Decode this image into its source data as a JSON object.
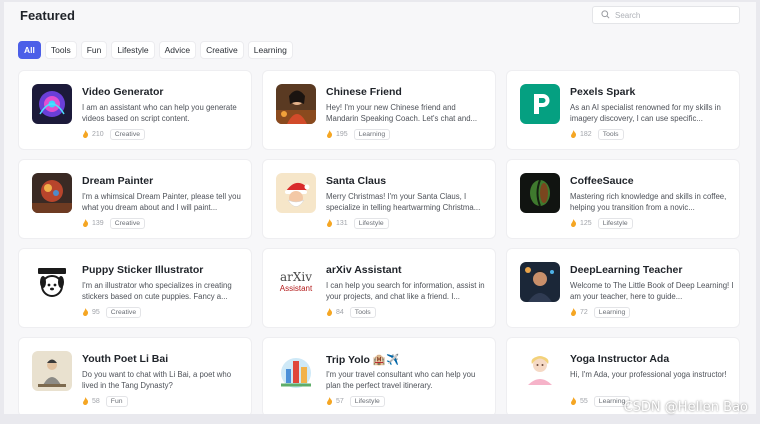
{
  "header": {
    "title": "Featured",
    "search_placeholder": "Search"
  },
  "tabs": [
    {
      "label": "All",
      "active": true
    },
    {
      "label": "Tools",
      "active": false
    },
    {
      "label": "Fun",
      "active": false
    },
    {
      "label": "Lifestyle",
      "active": false
    },
    {
      "label": "Advice",
      "active": false
    },
    {
      "label": "Creative",
      "active": false
    },
    {
      "label": "Learning",
      "active": false
    }
  ],
  "cards": [
    {
      "name": "Video Generator",
      "desc": "I am an assistant who can help you generate videos based on script content.",
      "hot": "210",
      "tag": "Creative",
      "icon": "video-generator-avatar"
    },
    {
      "name": "Chinese Friend",
      "desc": "Hey! I'm your new Chinese friend and Mandarin Speaking Coach. Let's chat and...",
      "hot": "195",
      "tag": "Learning",
      "icon": "chinese-friend-avatar"
    },
    {
      "name": "Pexels Spark",
      "desc": "As an AI specialist renowned for my skills in imagery discovery, I can use specific...",
      "hot": "182",
      "tag": "Tools",
      "icon": "pexels-logo"
    },
    {
      "name": "Dream Painter",
      "desc": "I'm a whimsical Dream Painter, please tell you what you dream about and I will paint...",
      "hot": "139",
      "tag": "Creative",
      "icon": "dream-painter-avatar"
    },
    {
      "name": "Santa Claus",
      "desc": "Merry Christmas! I'm your Santa Claus, I specialize in telling heartwarming Christma...",
      "hot": "131",
      "tag": "Lifestyle",
      "icon": "santa-claus-avatar"
    },
    {
      "name": "CoffeeSauce",
      "desc": "Mastering rich knowledge and skills in coffee, helping you transition from a novic...",
      "hot": "125",
      "tag": "Lifestyle",
      "icon": "coffee-bean-avatar"
    },
    {
      "name": "Puppy Sticker Illustrator",
      "desc": "I'm an illustrator who specializes in creating stickers based on cute puppies. Fancy a...",
      "hot": "95",
      "tag": "Creative",
      "icon": "puppy-sticker-avatar"
    },
    {
      "name": "arXiv Assistant",
      "desc": "I can help you search for information, assist in your projects, and chat like a friend. I...",
      "hot": "84",
      "tag": "Tools",
      "icon": "arxiv-logo",
      "logo_text_1": "arXiv",
      "logo_text_2": "Assistant"
    },
    {
      "name": "DeepLearning Teacher",
      "desc": "Welcome to The Little Book of Deep Learning! I am your teacher, here to guide...",
      "hot": "72",
      "tag": "Learning",
      "icon": "deeplearning-teacher-avatar"
    },
    {
      "name": "Youth Poet Li Bai",
      "desc": "Do you want to chat with Li Bai, a poet who lived in the Tang Dynasty?",
      "hot": "58",
      "tag": "Fun",
      "icon": "li-bai-avatar"
    },
    {
      "name": "Trip Yolo 🏨✈️",
      "desc": "I'm your travel consultant who can help you plan the perfect travel itinerary.",
      "hot": "57",
      "tag": "Lifestyle",
      "icon": "travel-avatar"
    },
    {
      "name": "Yoga Instructor Ada",
      "desc": "Hi, I'm Ada, your professional yoga instructor!",
      "hot": "55",
      "tag": "Learning",
      "icon": "yoga-instructor-avatar"
    }
  ],
  "watermark": "CSDN @Hellen  Bao",
  "colors": {
    "accent": "#4c5fe8",
    "hot": "#f5a623",
    "pexels": "#05a081"
  }
}
